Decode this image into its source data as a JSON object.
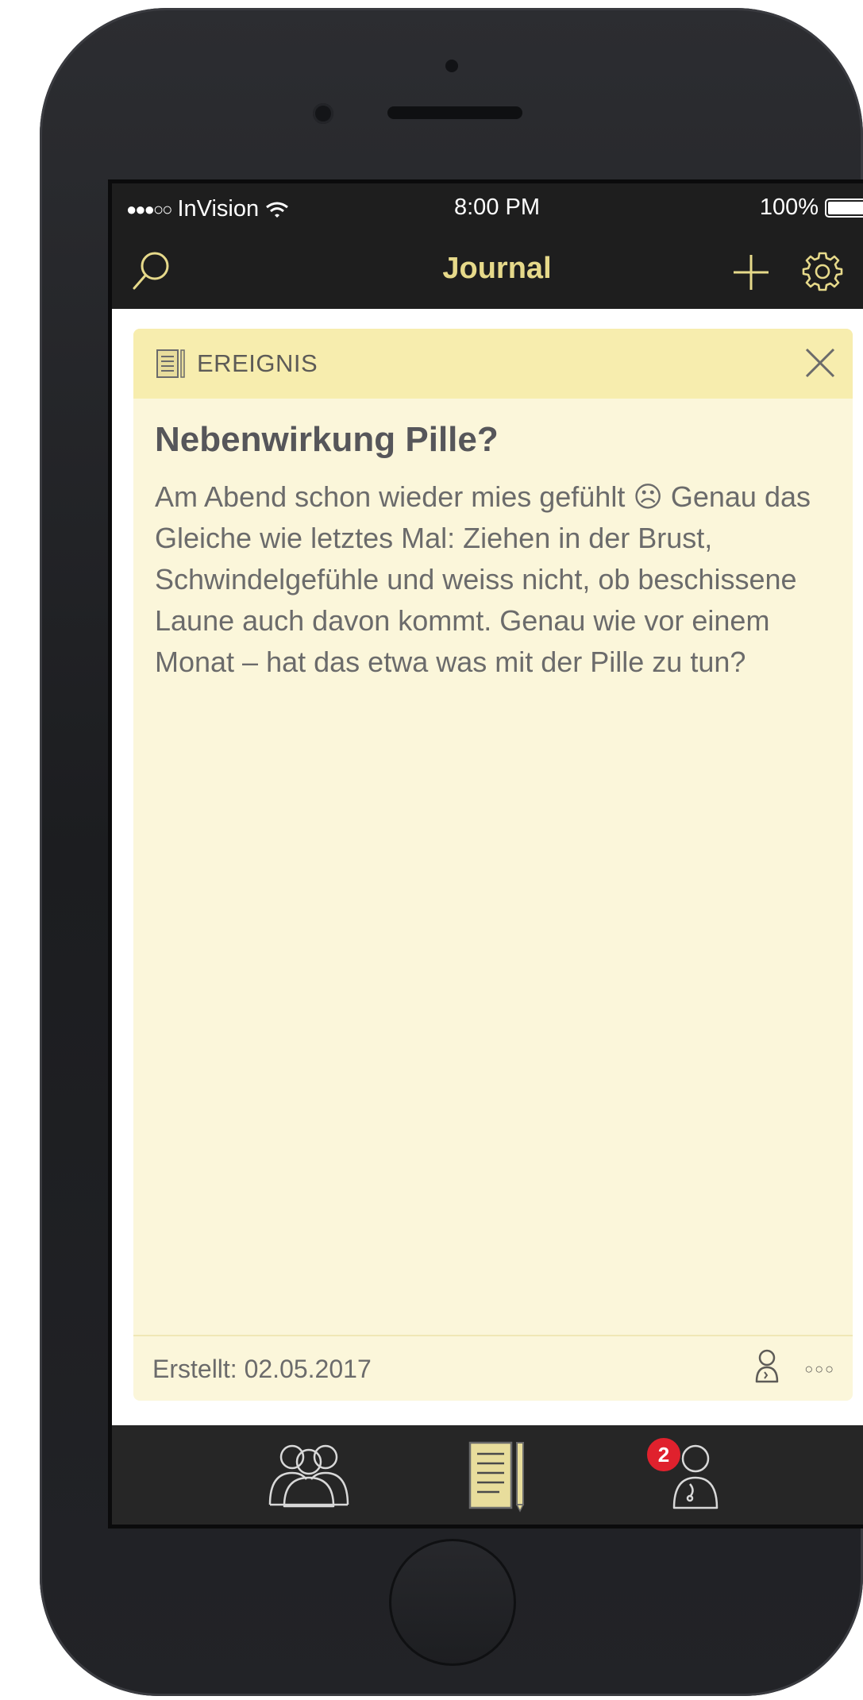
{
  "status_bar": {
    "signal_dots": "●●●○○",
    "carrier": "InVision",
    "time": "8:00 PM",
    "battery_percent": "100%",
    "battery_level": 1.0
  },
  "nav": {
    "title": "Journal",
    "search_icon": "search-icon",
    "add_icon": "plus-icon",
    "settings_icon": "gear-icon"
  },
  "card": {
    "type_label": "EREIGNIS",
    "type_icon": "journal-entry-icon",
    "title": "Nebenwirkung Pille?",
    "body": "Am Abend schon wieder mies gefühlt ☹ Genau das Gleiche wie letztes Mal: Ziehen in der Brust, Schwindelgefühle und weiss nicht, ob beschissene Laune auch davon kommt. Genau wie vor einem Monat – hat das etwa was mit der Pille zu tun?",
    "created": "Erstellt: 02.05.2017",
    "more_label": "○○○"
  },
  "tabs": [
    {
      "name": "community",
      "icon": "group-icon",
      "active": false
    },
    {
      "name": "journal",
      "icon": "journal-icon",
      "active": true
    },
    {
      "name": "doctor",
      "icon": "doctor-icon",
      "active": false,
      "badge": "2"
    }
  ],
  "colors": {
    "accent": "#e6d98a",
    "card_bg": "#fbf6da",
    "card_header": "#f7edae",
    "bar_bg": "#1e1e1e",
    "badge": "#e0212d"
  }
}
